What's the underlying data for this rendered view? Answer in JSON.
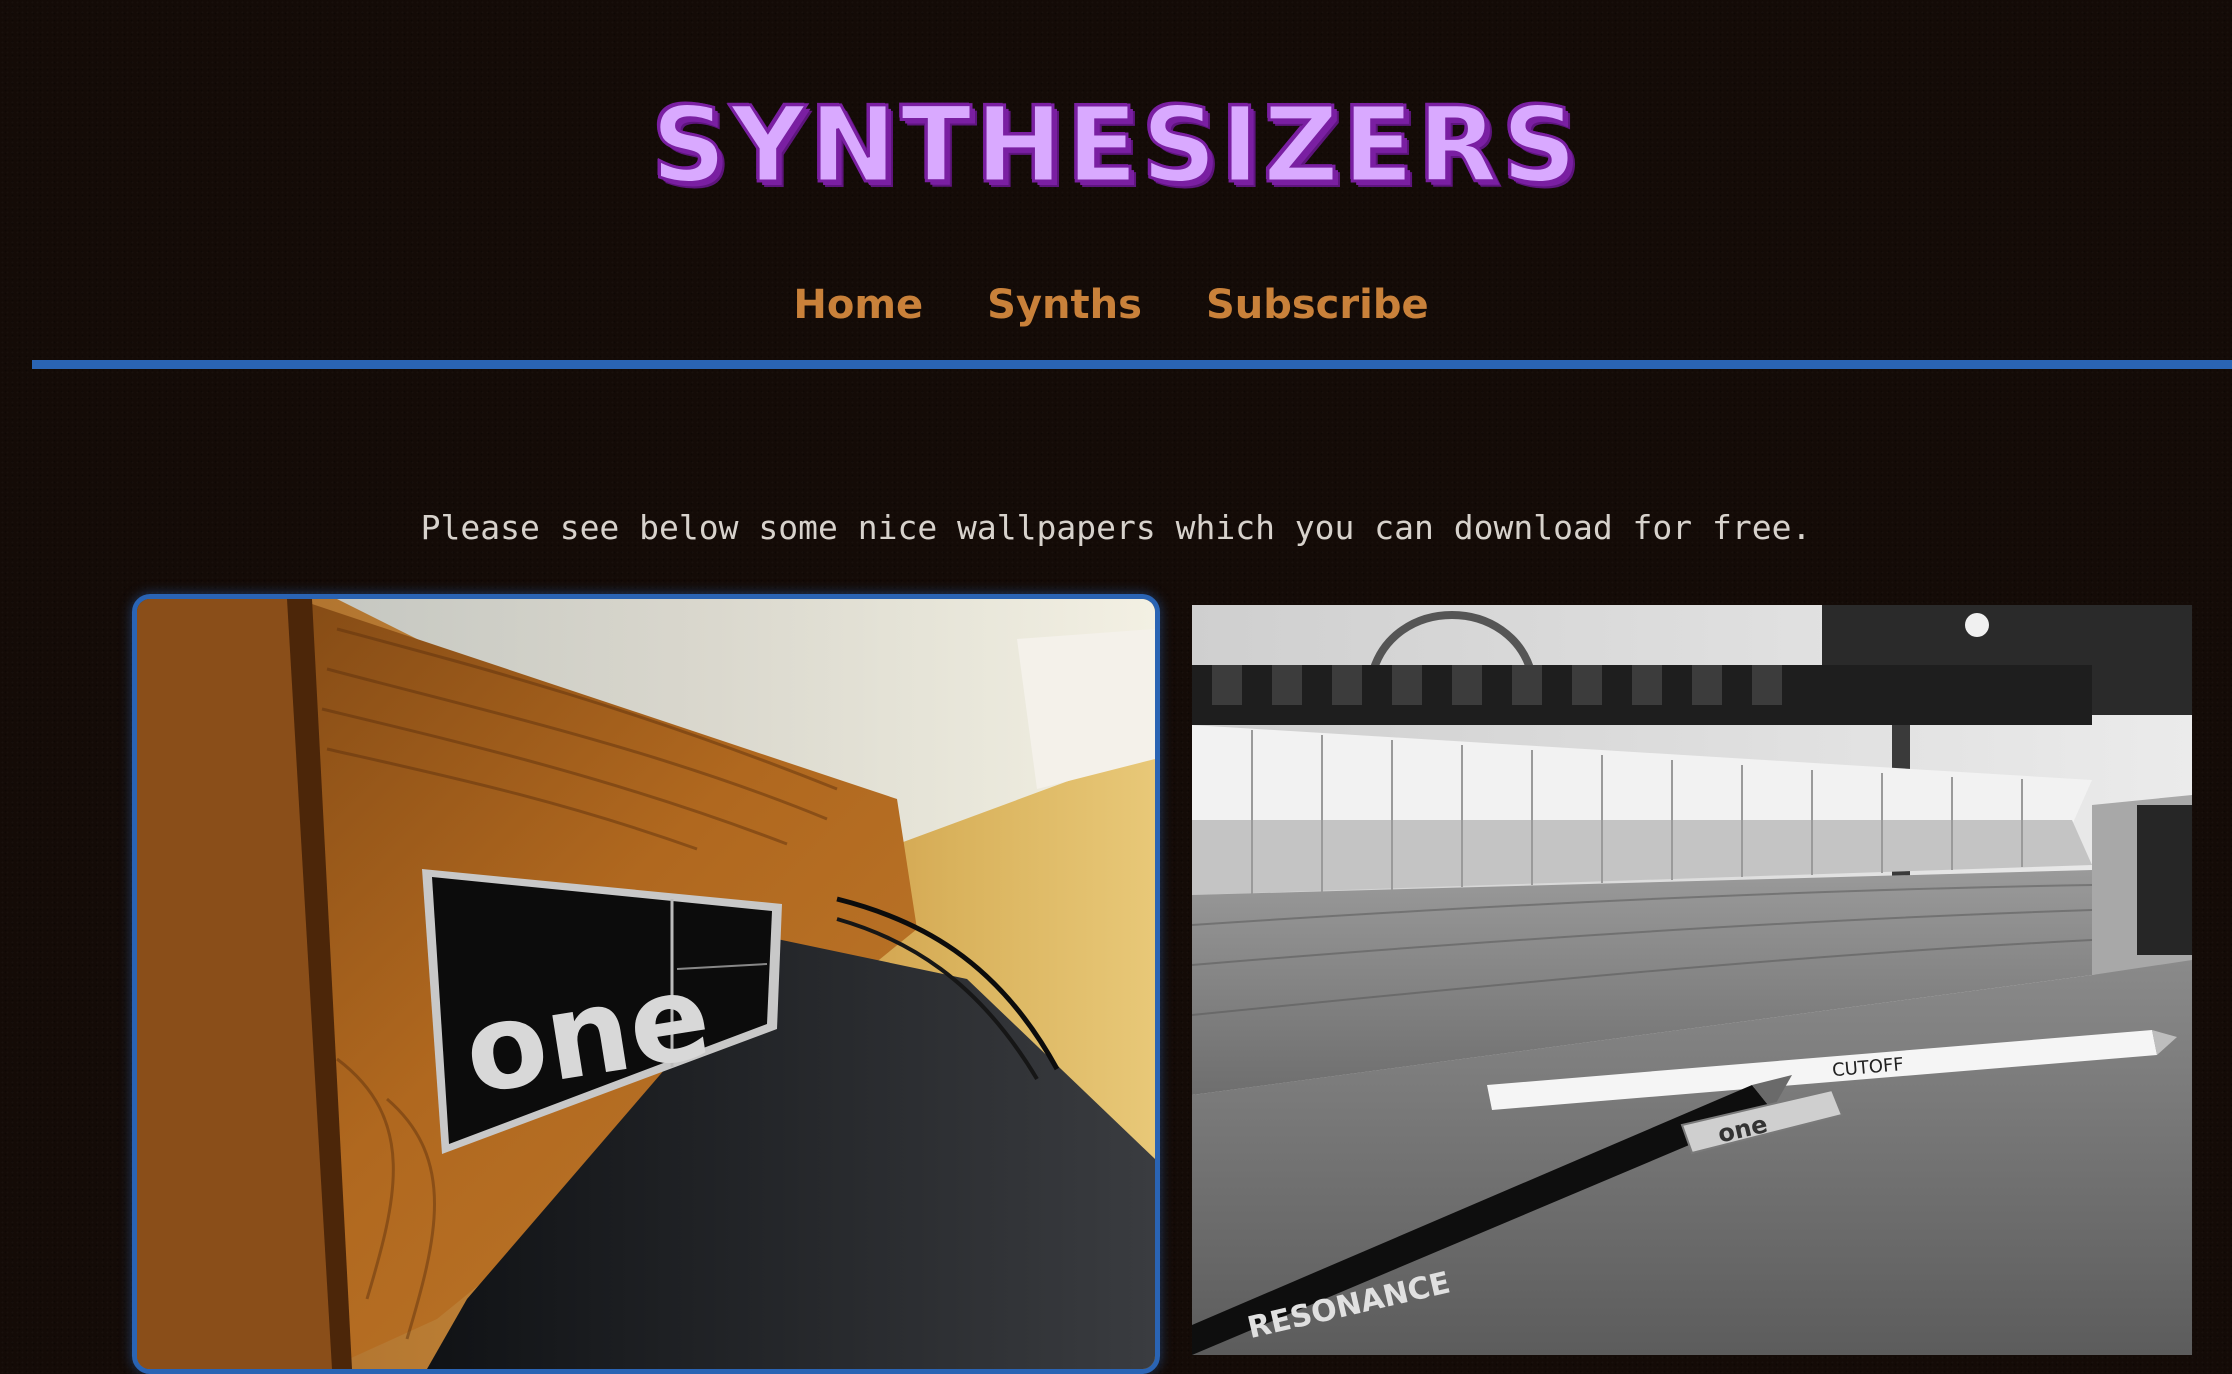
{
  "site": {
    "title": "SYNTHESIZERS"
  },
  "nav": {
    "items": [
      {
        "label": "Home"
      },
      {
        "label": "Synths"
      },
      {
        "label": "Subscribe"
      }
    ]
  },
  "intro": {
    "text": "Please see below some nice wallpapers which you can download for free."
  },
  "gallery": {
    "images": [
      {
        "badge_text": "one"
      },
      {
        "pencil_white_text": "CUTOFF",
        "pencil_black_text": "RESONANCE",
        "eraser_text": "one"
      }
    ]
  },
  "colors": {
    "background": "#140b07",
    "title_fill": "#d9a9ff",
    "title_outline": "#7a1fa2",
    "nav_link": "#c9813a",
    "divider": "#2a64b4",
    "intro_text": "#d7d2cc"
  }
}
